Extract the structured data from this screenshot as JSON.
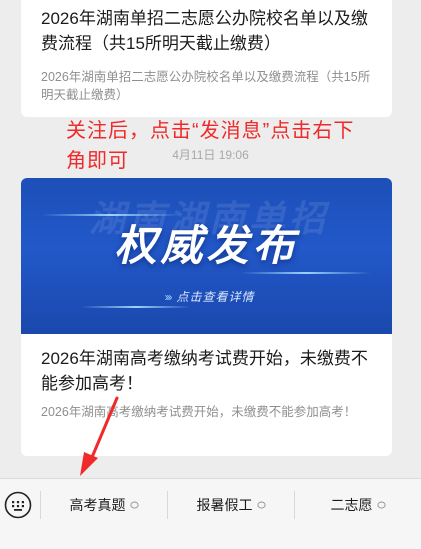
{
  "messages": [
    {
      "title": "2026年湖南单招二志愿公办院校名单以及缴费流程（共15所明天截止缴费）",
      "description": "2026年湖南单招二志愿公办院校名单以及缴费流程（共15所明天截止缴费）"
    },
    {
      "banner_watermark": "湖南湖南单招",
      "banner_headline": "权威发布",
      "banner_cta": "点击查看详情",
      "title": "2026年湖南高考缴纳考试费开始，未缴费不能参加高考！",
      "description": "2026年湖南高考缴纳考试费开始，未缴费不能参加高考！"
    }
  ],
  "timestamp": "4月11日 19:06",
  "annotation": "关注后，点击“发消息”点击右下角即可",
  "colors": {
    "annotation": "#f02a2a",
    "banner": "#2258c9"
  },
  "menu": {
    "keyboard_icon": "keyboard-icon",
    "items": [
      {
        "label": "高考真题",
        "icon": "chat-bubble-icon"
      },
      {
        "label": "报暑假工",
        "icon": "chat-bubble-icon"
      },
      {
        "label": "二志愿",
        "icon": "chat-bubble-icon"
      }
    ]
  }
}
